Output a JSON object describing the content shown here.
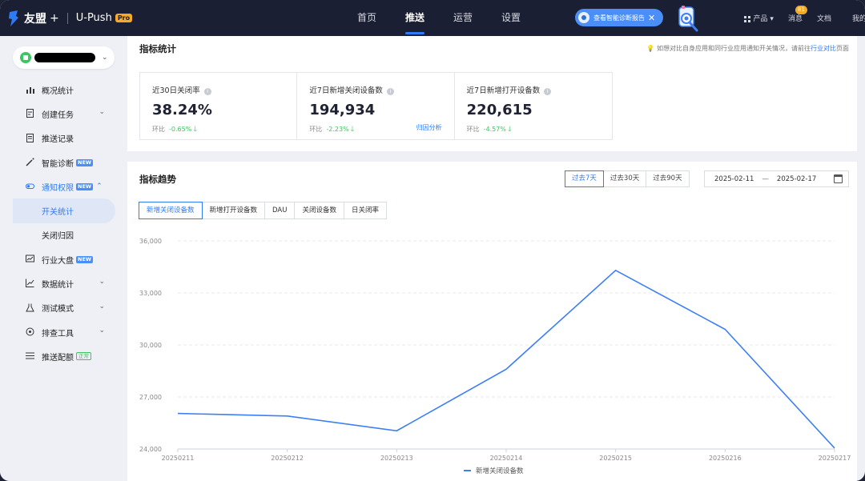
{
  "topbar": {
    "brand": "友盟",
    "plus": "+",
    "product": "U-Push",
    "pro_badge": "Pro",
    "nav": [
      "首页",
      "推送",
      "运营",
      "设置"
    ],
    "active_nav": 1,
    "diag_button": "查看智能诊断报告",
    "close_glyph": "✕",
    "products": "产品",
    "messages": "消息",
    "message_count": "81",
    "docs": "文档",
    "mine": "我的"
  },
  "sidebar": {
    "items": [
      {
        "label": "概况统计",
        "icon": "bar-chart-icon",
        "chevron": false
      },
      {
        "label": "创建任务",
        "icon": "edit-doc-icon",
        "chevron": true
      },
      {
        "label": "推送记录",
        "icon": "record-icon",
        "chevron": false
      },
      {
        "label": "智能诊断",
        "icon": "magic-wand-icon",
        "chevron": false,
        "badge": "NEW"
      },
      {
        "label": "通知权限",
        "icon": "toggle-icon",
        "chevron": true,
        "badge": "NEW",
        "expanded": true
      },
      {
        "label": "开关统计",
        "sub": true,
        "selected": true
      },
      {
        "label": "关闭归因",
        "sub": true
      },
      {
        "label": "行业大盘",
        "icon": "dashboard-icon",
        "chevron": false,
        "badge": "NEW"
      },
      {
        "label": "数据统计",
        "icon": "line-chart-icon",
        "chevron": true
      },
      {
        "label": "测试模式",
        "icon": "flask-icon",
        "chevron": true
      },
      {
        "label": "排查工具",
        "icon": "gear-icon",
        "chevron": true
      },
      {
        "label": "推送配额",
        "icon": "list-icon",
        "chevron": false,
        "badge2": "正常"
      }
    ]
  },
  "summary": {
    "title": "指标统计",
    "hint_prefix": "如想对比自身应用和同行业应用通知开关情况，请前往",
    "hint_link": "行业对比",
    "hint_suffix": "页面",
    "stats": [
      {
        "label": "近30日关闭率",
        "value": "38.24%",
        "change_label": "环比",
        "change": "-0.65%"
      },
      {
        "label": "近7日新增关闭设备数",
        "value": "194,934",
        "change_label": "环比",
        "change": "-2.23%",
        "link": "归因分析"
      },
      {
        "label": "近7日新增打开设备数",
        "value": "220,615",
        "change_label": "环比",
        "change": "-4.57%"
      }
    ]
  },
  "trend": {
    "title": "指标趋势",
    "ranges": [
      "过去7天",
      "过去30天",
      "过去90天"
    ],
    "active_range": 0,
    "date_start": "2025-02-11",
    "date_end": "2025-02-17",
    "date_dash": "—",
    "metric_tabs": [
      "新增关闭设备数",
      "新增打开设备数",
      "DAU",
      "关闭设备数",
      "日关闭率"
    ],
    "active_metric": 0
  },
  "chart_data": {
    "type": "line",
    "x": [
      "20250211",
      "20250212",
      "20250213",
      "20250214",
      "20250215",
      "20250216",
      "20250217"
    ],
    "series": [
      {
        "name": "新增关闭设备数",
        "values": [
          26050,
          25900,
          25050,
          28600,
          34300,
          30900,
          24050
        ],
        "color": "#3d7ff5"
      }
    ],
    "yticks": [
      "24,000",
      "27,000",
      "30,000",
      "33,000",
      "36,000"
    ],
    "ylim": [
      24000,
      36000
    ],
    "grid": true,
    "legend": "bottom-center"
  }
}
